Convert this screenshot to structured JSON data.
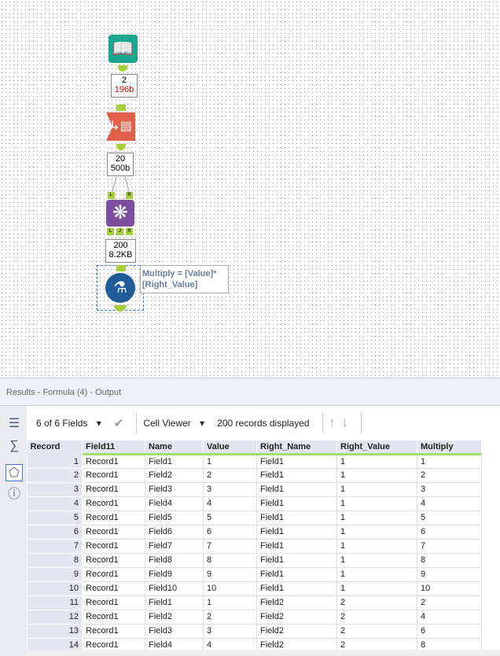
{
  "workflow": {
    "badge1": {
      "count": "2",
      "size": "196b"
    },
    "badge2": {
      "count": "20",
      "size": "500b"
    },
    "badge3": {
      "count": "200",
      "size": "8.2KB"
    },
    "join_anchors_in": [
      "L",
      "R"
    ],
    "join_anchors_out": [
      "L",
      "J",
      "R"
    ],
    "formula_annotation": "Multiply = [Value]* [Right_Value]",
    "colors": {
      "input": "#1aa58f",
      "transpose": "#e0604a",
      "join": "#7c4f9e",
      "formula": "#1f5c99",
      "connector": "#a6ce39"
    }
  },
  "results": {
    "title": "Results - Formula (4) - Output",
    "fields_label": "6 of 6 Fields",
    "viewer_label": "Cell Viewer",
    "records_label": "200 records displayed",
    "columns": [
      "Record",
      "Field11",
      "Name",
      "Value",
      "Right_Name",
      "Right_Value",
      "Multiply"
    ],
    "rows": [
      [
        "1",
        "Record1",
        "Field1",
        "1",
        "Field1",
        "1",
        "1"
      ],
      [
        "2",
        "Record1",
        "Field2",
        "2",
        "Field1",
        "1",
        "2"
      ],
      [
        "3",
        "Record1",
        "Field3",
        "3",
        "Field1",
        "1",
        "3"
      ],
      [
        "4",
        "Record1",
        "Field4",
        "4",
        "Field1",
        "1",
        "4"
      ],
      [
        "5",
        "Record1",
        "Field5",
        "5",
        "Field1",
        "1",
        "5"
      ],
      [
        "6",
        "Record1",
        "Field6",
        "6",
        "Field1",
        "1",
        "6"
      ],
      [
        "7",
        "Record1",
        "Field7",
        "7",
        "Field1",
        "1",
        "7"
      ],
      [
        "8",
        "Record1",
        "Field8",
        "8",
        "Field1",
        "1",
        "8"
      ],
      [
        "9",
        "Record1",
        "Field9",
        "9",
        "Field1",
        "1",
        "9"
      ],
      [
        "10",
        "Record1",
        "Field10",
        "10",
        "Field1",
        "1",
        "10"
      ],
      [
        "11",
        "Record1",
        "Field1",
        "1",
        "Field2",
        "2",
        "2"
      ],
      [
        "12",
        "Record1",
        "Field2",
        "2",
        "Field2",
        "2",
        "4"
      ],
      [
        "13",
        "Record1",
        "Field3",
        "3",
        "Field2",
        "2",
        "6"
      ],
      [
        "14",
        "Record1",
        "Field4",
        "4",
        "Field2",
        "2",
        "8"
      ]
    ]
  }
}
